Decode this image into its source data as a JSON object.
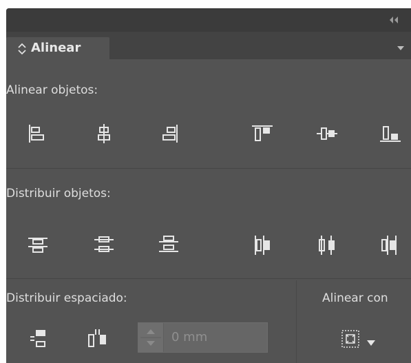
{
  "panel": {
    "tab_label": "Alinear",
    "sections": {
      "align_objects": "Alinear objetos:",
      "distribute_objects": "Distribuir objetos:",
      "distribute_spacing": "Distribuir espaciado:",
      "align_to": "Alinear con"
    },
    "spacing_field": {
      "value": "0 mm"
    },
    "icons": {
      "collapse": "double-chevron-left-icon",
      "tab_updown": "up-down-arrows-icon",
      "panel_menu": "panel-menu-icon",
      "align_left": "align-left-edges-icon",
      "align_hcenter": "align-horizontal-centers-icon",
      "align_right": "align-right-edges-icon",
      "align_top": "align-top-edges-icon",
      "align_vcenter": "align-vertical-centers-icon",
      "align_bottom": "align-bottom-edges-icon",
      "dist_top": "distribute-top-edges-icon",
      "dist_vcenter": "distribute-vertical-centers-icon",
      "dist_bottom": "distribute-bottom-edges-icon",
      "dist_left": "distribute-left-edges-icon",
      "dist_hcenter": "distribute-horizontal-centers-icon",
      "dist_right": "distribute-right-edges-icon",
      "space_vertical": "distribute-vertical-space-icon",
      "space_horizontal": "distribute-horizontal-space-icon",
      "align_to_selection": "align-to-selection-icon"
    }
  }
}
